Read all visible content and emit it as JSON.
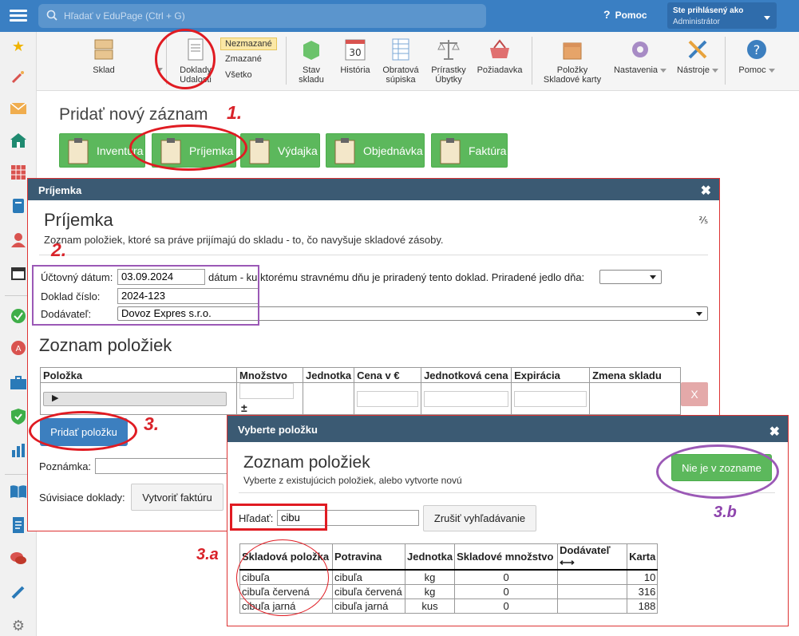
{
  "topbar": {
    "search_placeholder": "Hľadať v EduPage (Ctrl + G)",
    "help_label": "Pomoc",
    "user_line1": "Ste prihlásený ako",
    "user_line2": "Administrátor"
  },
  "toolbar": {
    "sklad": "Sklad",
    "doklady": "Doklady",
    "udalosti": "Udalosti",
    "filters": [
      "Nezmazané",
      "Zmazané",
      "Všetko"
    ],
    "stav1": "Stav",
    "stav2": "skladu",
    "historia": "História",
    "calendar_day": "30",
    "obratova1": "Obratová",
    "obratova2": "súpiska",
    "prirastky1": "Prírastky",
    "prirastky2": "Úbytky",
    "poziadavka": "Požiadavka",
    "polozky1": "Položky",
    "polozky2": "Skladové karty",
    "nastavenia": "Nastavenia",
    "nastroje": "Nástroje",
    "pomoc": "Pomoc"
  },
  "add": {
    "title": "Pridať nový záznam",
    "buttons": [
      "Inventúra",
      "Príjemka",
      "Výdajka",
      "Objednávka",
      "Faktúra"
    ]
  },
  "annotations": {
    "a1": "1.",
    "a2": "2.",
    "a3": "3.",
    "a3a": "3.a",
    "a3b": "3.b"
  },
  "prijemka": {
    "header": "Príjemka",
    "close": "✖",
    "title": "Príjemka",
    "subtitle": "Zoznam položiek, ktoré sa práve prijímajú do skladu - to, čo navyšuje skladové zásoby.",
    "page": "⅖",
    "date_label": "Účtovný dátum:",
    "date_value": "03.09.2024",
    "date_note": "dátum - ku ktorému stravnému dňu je priradený tento doklad. Priradené jedlo dňa:",
    "doc_label": "Doklad číslo:",
    "doc_value": "2024-123",
    "supplier_label": "Dodávateľ:",
    "supplier_value": "Dovoz Expres s.r.o.",
    "list_title": "Zoznam položiek",
    "columns": [
      "Položka",
      "Množstvo",
      "Jednotka",
      "Cena v €",
      "Jednotková cena",
      "Expirácia",
      "Zmena skladu"
    ],
    "row_marker": "▶",
    "row_x": "X",
    "add_button": "Pridať položku",
    "note_label": "Poznámka:",
    "related_label": "Súvisiace doklady:",
    "invoice_button": "Vytvoriť faktúru"
  },
  "picker": {
    "header": "Vyberte položku",
    "close": "✖",
    "title": "Zoznam položiek",
    "subtitle": "Vyberte z existujúcich položiek, alebo vytvorte novú",
    "not_in_list": "Nie je v zozname",
    "search_label": "Hľadať:",
    "search_value": "cibu",
    "cancel_search": "Zrušiť vyhľadávanie",
    "columns": [
      "Skladová položka",
      "Potravina",
      "Jednotka",
      "Skladové množstvo",
      "Dodávateľ ⟷",
      "Karta"
    ],
    "rows": [
      [
        "cibuľa",
        "cibuľa",
        "kg",
        "0",
        "",
        "10"
      ],
      [
        "cibuľa červená",
        "cibuľa červená",
        "kg",
        "0",
        "",
        "316"
      ],
      [
        "cibuľa jarná",
        "cibuľa jarná",
        "kus",
        "0",
        "",
        "188"
      ]
    ]
  },
  "colors": {
    "topbar": "#3a7fc3",
    "green": "#5cb85c",
    "blue": "#3c7fbf",
    "red_annotation": "#d9232a",
    "purple_annotation": "#8e44ad",
    "modal_header": "#3b5a73"
  }
}
